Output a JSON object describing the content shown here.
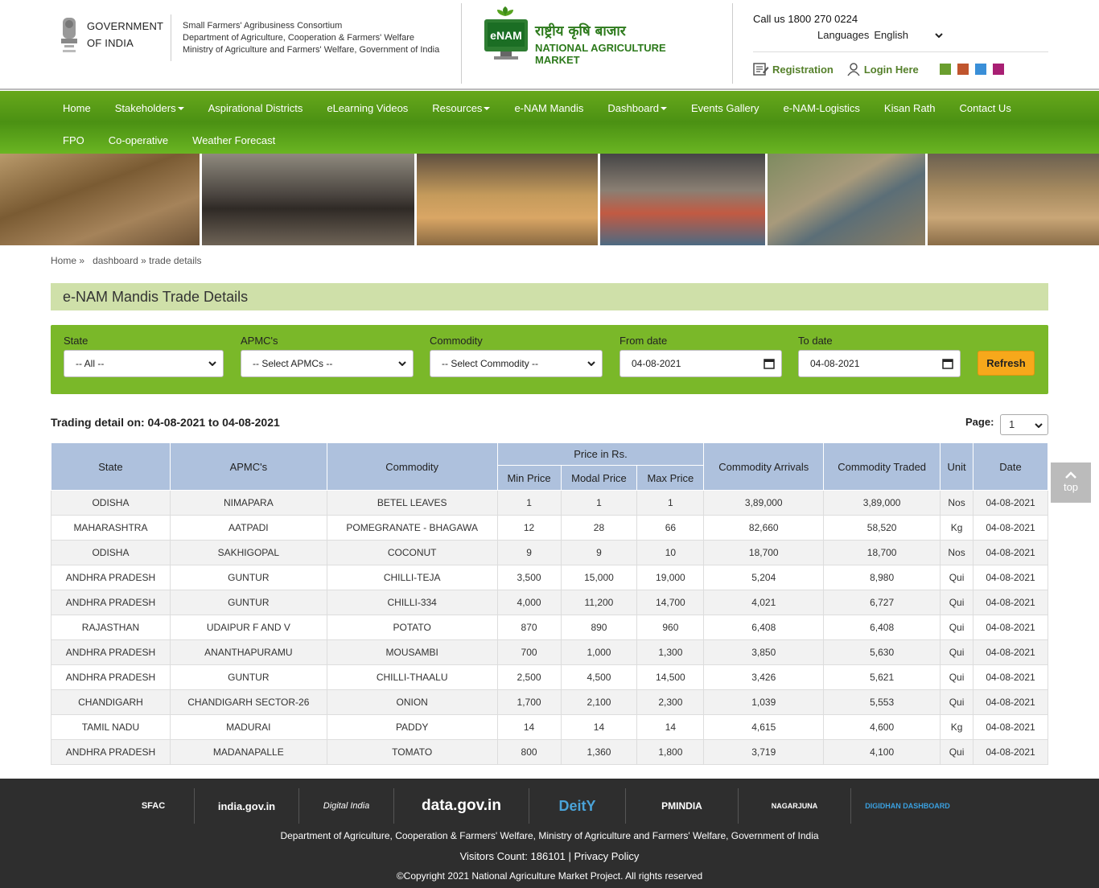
{
  "header": {
    "goi_line1": "GOVERNMENT",
    "goi_line2": "OF INDIA",
    "sfac_line1": "Small Farmers' Agribusiness Consortium",
    "sfac_line2": "Department of Agriculture, Cooperation & Farmers' Welfare",
    "sfac_line3": "Ministry of Agriculture and Farmers' Welfare, Government of India",
    "logo_badge": "eNAM",
    "logo_hindi": "राष्ट्रीय कृषि बाजार",
    "logo_english": "NATIONAL AGRICULTURE MARKET",
    "call": "Call us 1800 270 0224",
    "languages_label": "Languages",
    "language_value": "English",
    "registration": "Registration",
    "login": "Login Here",
    "theme_colors": [
      "#6a9e2e",
      "#c0552e",
      "#3a8fd8",
      "#a81f73"
    ]
  },
  "nav": {
    "row1": [
      "Home",
      "Stakeholders",
      "Aspirational Districts",
      "eLearning Videos",
      "Resources",
      "e-NAM Mandis",
      "Dashboard",
      "Events Gallery",
      "e-NAM-Logistics",
      "Kisan Rath",
      "Contact Us"
    ],
    "row2": [
      "FPO",
      "Co-operative",
      "Weather Forecast"
    ]
  },
  "breadcrumb": {
    "home": "Home",
    "sep": "»",
    "dashboard": "dashboard",
    "current": "trade details"
  },
  "page_title": "e-NAM Mandis Trade Details",
  "filters": {
    "state_label": "State",
    "state_value": "-- All --",
    "apmc_label": "APMC's",
    "apmc_value": "-- Select APMCs --",
    "commodity_label": "Commodity",
    "commodity_value": "-- Select Commodity --",
    "from_label": "From date",
    "from_value": "04-08-2021",
    "to_label": "To date",
    "to_value": "04-08-2021",
    "refresh": "Refresh"
  },
  "trading_text": "Trading detail on: 04-08-2021 to 04-08-2021",
  "page_label": "Page:",
  "page_value": "1",
  "table": {
    "headers": {
      "state": "State",
      "apmc": "APMC's",
      "commodity": "Commodity",
      "price": "Price in Rs.",
      "min": "Min Price",
      "modal": "Modal Price",
      "max": "Max Price",
      "arrivals": "Commodity Arrivals",
      "traded": "Commodity Traded",
      "unit": "Unit",
      "date": "Date"
    },
    "rows": [
      [
        "ODISHA",
        "NIMAPARA",
        "BETEL LEAVES",
        "1",
        "1",
        "1",
        "3,89,000",
        "3,89,000",
        "Nos",
        "04-08-2021"
      ],
      [
        "MAHARASHTRA",
        "AATPADI",
        "POMEGRANATE - BHAGAWA",
        "12",
        "28",
        "66",
        "82,660",
        "58,520",
        "Kg",
        "04-08-2021"
      ],
      [
        "ODISHA",
        "SAKHIGOPAL",
        "COCONUT",
        "9",
        "9",
        "10",
        "18,700",
        "18,700",
        "Nos",
        "04-08-2021"
      ],
      [
        "ANDHRA PRADESH",
        "GUNTUR",
        "CHILLI-TEJA",
        "3,500",
        "15,000",
        "19,000",
        "5,204",
        "8,980",
        "Qui",
        "04-08-2021"
      ],
      [
        "ANDHRA PRADESH",
        "GUNTUR",
        "CHILLI-334",
        "4,000",
        "11,200",
        "14,700",
        "4,021",
        "6,727",
        "Qui",
        "04-08-2021"
      ],
      [
        "RAJASTHAN",
        "UDAIPUR F AND V",
        "POTATO",
        "870",
        "890",
        "960",
        "6,408",
        "6,408",
        "Qui",
        "04-08-2021"
      ],
      [
        "ANDHRA PRADESH",
        "ANANTHAPURAMU",
        "MOUSAMBI",
        "700",
        "1,000",
        "1,300",
        "3,850",
        "5,630",
        "Qui",
        "04-08-2021"
      ],
      [
        "ANDHRA PRADESH",
        "GUNTUR",
        "CHILLI-THAALU",
        "2,500",
        "4,500",
        "14,500",
        "3,426",
        "5,621",
        "Qui",
        "04-08-2021"
      ],
      [
        "CHANDIGARH",
        "CHANDIGARH SECTOR-26",
        "ONION",
        "1,700",
        "2,100",
        "2,300",
        "1,039",
        "5,553",
        "Qui",
        "04-08-2021"
      ],
      [
        "TAMIL NADU",
        "MADURAI",
        "PADDY",
        "14",
        "14",
        "14",
        "4,615",
        "4,600",
        "Kg",
        "04-08-2021"
      ],
      [
        "ANDHRA PRADESH",
        "MADANAPALLE",
        "TOMATO",
        "800",
        "1,360",
        "1,800",
        "3,719",
        "4,100",
        "Qui",
        "04-08-2021"
      ]
    ]
  },
  "top_label": "top",
  "footer": {
    "logos": [
      "SFAC",
      "india.gov.in",
      "Digital India",
      "data.gov.in",
      "DeitY",
      "PMINDIA",
      "NAGARJUNA",
      "DIGIDHAN DASHBOARD"
    ],
    "line1": "Department of Agriculture, Cooperation & Farmers' Welfare, Ministry of Agriculture and Farmers' Welfare, Government of India",
    "line2": "Visitors Count: 186101 | Privacy Policy",
    "line3": "©Copyright 2021 National Agriculture Market Project. All rights reserved"
  }
}
